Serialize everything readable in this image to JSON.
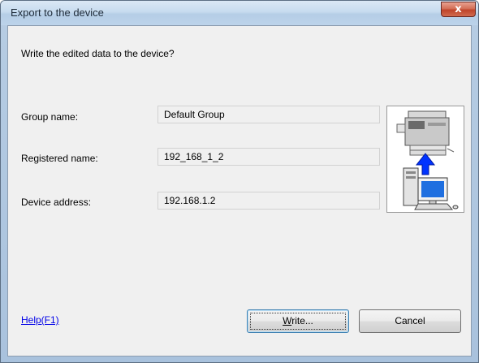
{
  "window": {
    "title": "Export to the device",
    "close_glyph": "x"
  },
  "dialog": {
    "prompt": "Write the edited data to the device?",
    "group_name_label": "Group name:",
    "group_name_value": "Default Group",
    "registered_name_label": "Registered name:",
    "registered_name_value": "192_168_1_2",
    "device_address_label": "Device address:",
    "device_address_value": "192.168.1.2",
    "illustration_icon": "pc-to-multifunction-printer-icon"
  },
  "footer": {
    "help_link": "Help(F1)",
    "write_button_mnemonic": "W",
    "write_button_rest": "rite...",
    "cancel_button": "Cancel"
  },
  "colors": {
    "link": "#0000e8",
    "arrow": "#0033ff",
    "close_button": "#c0442a"
  }
}
